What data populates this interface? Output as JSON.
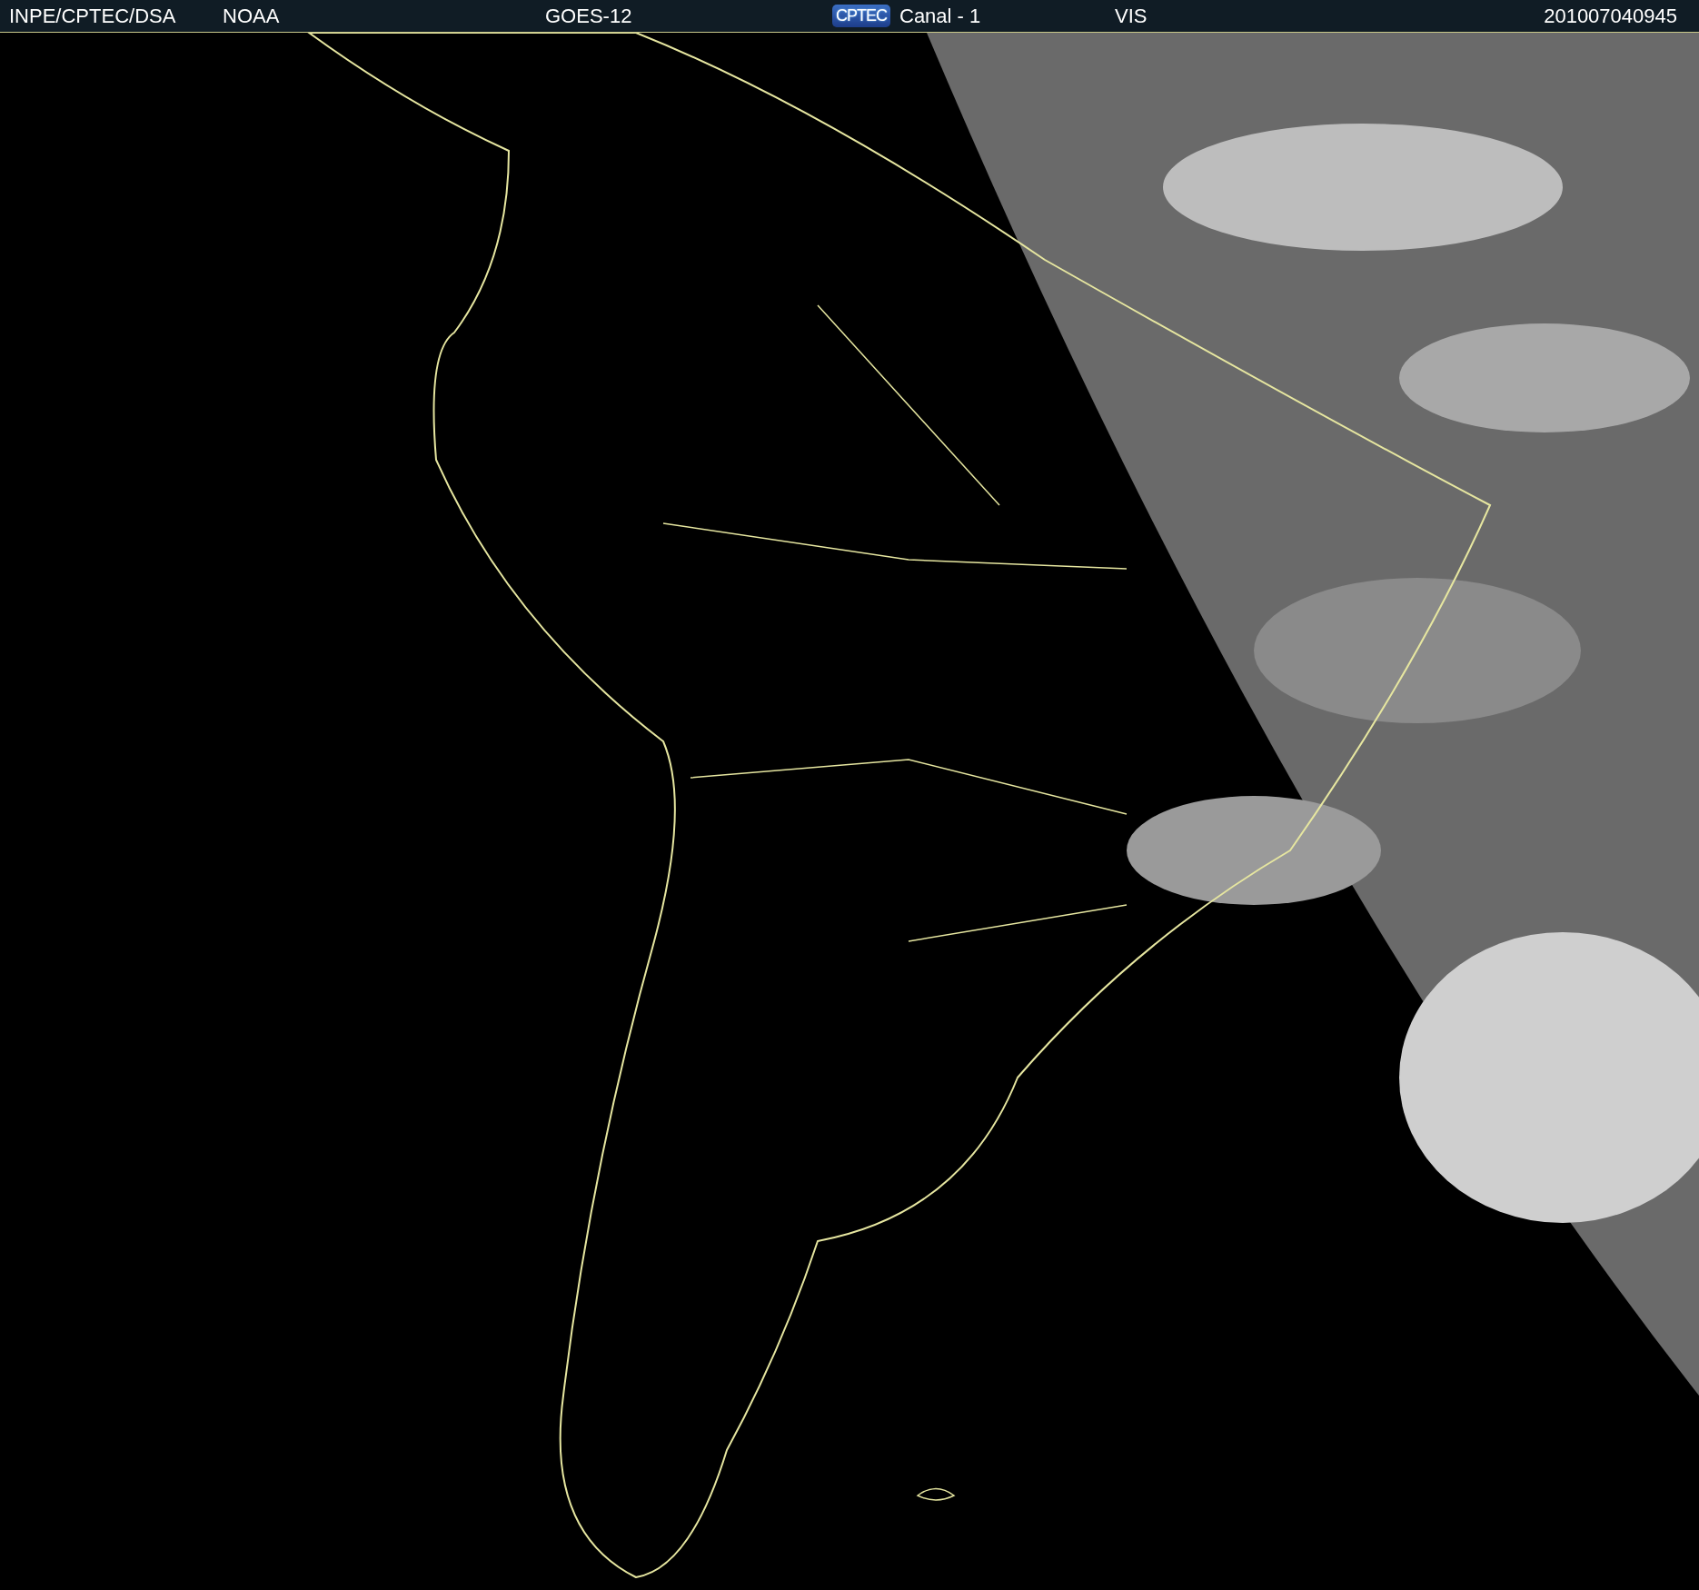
{
  "header": {
    "source": "INPE/CPTEC/DSA",
    "agency": "NOAA",
    "satellite": "GOES-12",
    "logo": "CPTEC",
    "channel": "Canal - 1",
    "band": "VIS",
    "timestamp": "201007040945"
  }
}
